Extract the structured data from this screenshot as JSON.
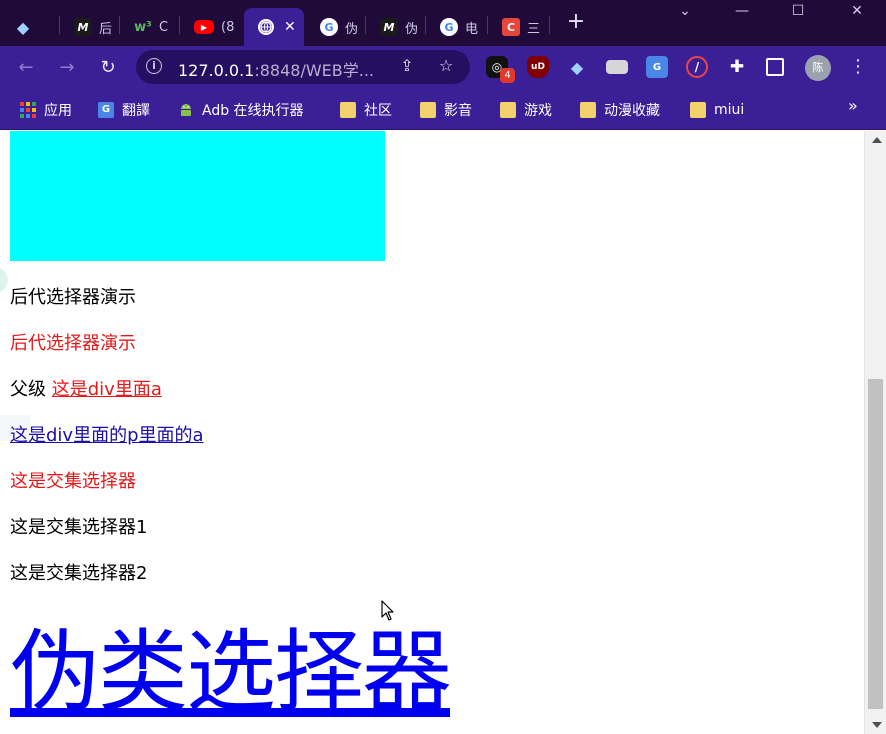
{
  "browser": {
    "tabs": [
      {
        "title": "",
        "favicon": "gem-icon",
        "fav_text": "◆",
        "fav_color": "#9fd0ff"
      },
      {
        "title": "后",
        "favicon": "m-logo-icon",
        "fav_text": "M",
        "fav_color": "#111111"
      },
      {
        "title": "C",
        "favicon": "w3-icon",
        "fav_text": "w³",
        "fav_color": "#3d9b3d"
      },
      {
        "title": "(8",
        "favicon": "youtube-icon",
        "fav_text": "▶",
        "fav_color": "#ff0000"
      },
      {
        "title": "",
        "favicon": "globe-icon",
        "fav_text": "◍",
        "fav_color": "#ffffff"
      },
      {
        "title": "伪",
        "favicon": "google-icon",
        "fav_text": "G",
        "fav_color": "#ffffff"
      },
      {
        "title": "伪",
        "favicon": "m-logo-icon",
        "fav_text": "M",
        "fav_color": "#111111"
      },
      {
        "title": "电",
        "favicon": "google-icon",
        "fav_text": "G",
        "fav_color": "#ffffff"
      },
      {
        "title": "三",
        "favicon": "c-logo-icon",
        "fav_text": "C",
        "fav_color": "#e8453c"
      }
    ],
    "active_tab_index": 4,
    "new_tab_label": "+",
    "address": {
      "host": "127.0.0.1",
      "rest": ":8848/WEB学..."
    },
    "extension_badge": "4",
    "profile_label": "陈",
    "bookmarks": [
      {
        "label": "应用",
        "icon": "apps-grid-icon"
      },
      {
        "label": "翻譯",
        "icon": "translate-icon"
      },
      {
        "label": "Adb 在线执行器",
        "icon": "android-icon"
      },
      {
        "label": "社区",
        "icon": "folder-icon"
      },
      {
        "label": "影音",
        "icon": "folder-icon"
      },
      {
        "label": "游戏",
        "icon": "folder-icon"
      },
      {
        "label": "动漫收藏",
        "icon": "folder-icon"
      },
      {
        "label": "miui",
        "icon": "folder-icon"
      }
    ],
    "bookmarks_overflow": "»"
  },
  "page": {
    "cyan_box_color": "#00ffff",
    "paragraphs": {
      "descendant_demo_1": "后代选择器演示",
      "descendant_demo_2": "后代选择器演示",
      "parent_prefix": "父级",
      "div_link": "这是div里面a",
      "div_p_link": "这是div里面的p里面的a",
      "intersection_1": "这是交集选择器",
      "intersection_2": "这是交集选择器1",
      "intersection_3": "这是交集选择器2"
    },
    "heading_link": "伪类选择器",
    "colors": {
      "red_text": "#e41a1a",
      "link_blue": "#1a0dab",
      "heading_link": "#0000ee"
    }
  }
}
